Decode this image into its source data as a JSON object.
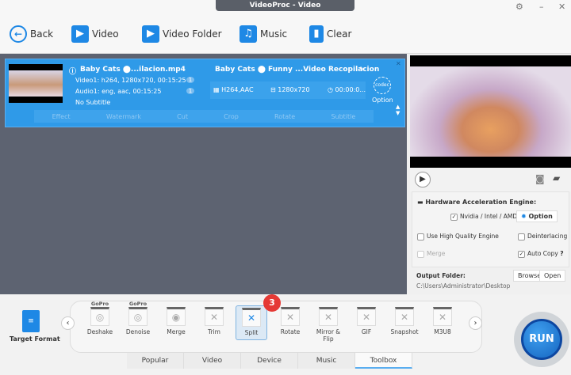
{
  "window": {
    "title": "VideoProc - Video"
  },
  "toolbar": {
    "back": "Back",
    "video": "Video",
    "video_folder": "Video Folder",
    "music": "Music",
    "clear": "Clear"
  },
  "item": {
    "source_name": "Baby Cats ⬤...ilacion.mp4",
    "video_track": "Video1: h264, 1280x720, 00:15:25",
    "audio_track": "Audio1: eng, aac, 00:15:25",
    "subtitle": "No Subtitle",
    "video_count": "1",
    "audio_count": "1",
    "output_name": "Baby Cats ⬤ Funny ...Video Recopilacion",
    "codec": "H264,AAC",
    "resolution": "1280x720",
    "duration": "00:00:0...",
    "option": "Option",
    "codec_label": "codec",
    "edit": [
      "Effect",
      "Watermark",
      "Cut",
      "Crop",
      "Rotate",
      "Subtitle"
    ]
  },
  "settings": {
    "hw_title": "Hardware Acceleration Engine:",
    "nvidia": "Nvidia / Intel / AMD",
    "nvidia_checked": true,
    "option": "Option",
    "high_quality": "Use High Quality Engine",
    "high_quality_checked": false,
    "deinterlacing": "Deinterlacing",
    "deinterlacing_checked": false,
    "merge": "Merge",
    "merge_checked": false,
    "auto_copy": "Auto Copy",
    "auto_copy_checked": true,
    "help": "?",
    "output_folder": "Output Folder:",
    "browse": "Browse",
    "open": "Open",
    "path": "C:\\Users\\Administrator\\Desktop"
  },
  "bottom": {
    "target_format": "Target Format",
    "badge": "3",
    "run": "RUN",
    "tools": [
      "Deshake",
      "Denoise",
      "Merge",
      "Trim",
      "Split",
      "Rotate",
      "Mirror & Flip",
      "GIF",
      "Snapshot",
      "M3U8"
    ],
    "gopro": "GoPro",
    "selected_tool": "Split",
    "tabs": [
      "Popular",
      "Video",
      "Device",
      "Music",
      "Toolbox"
    ],
    "active_tab": "Toolbox"
  },
  "colors": {
    "accent": "#2f9ae8",
    "run": "#1565c0",
    "badge": "#e53935"
  }
}
